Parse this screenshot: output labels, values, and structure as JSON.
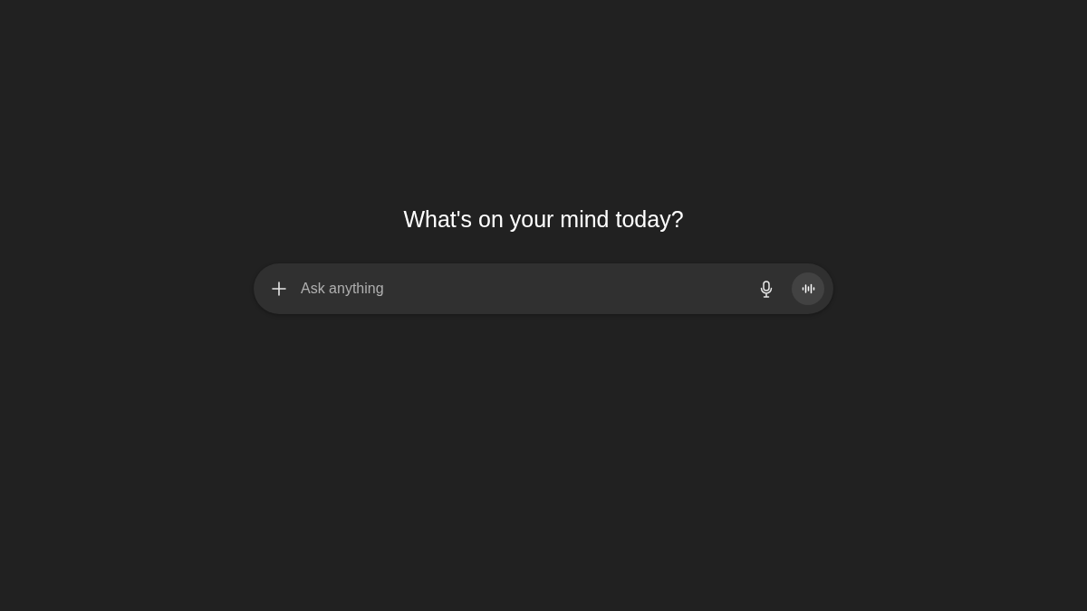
{
  "heading": "What's on your mind today?",
  "composer": {
    "placeholder": "Ask anything"
  }
}
